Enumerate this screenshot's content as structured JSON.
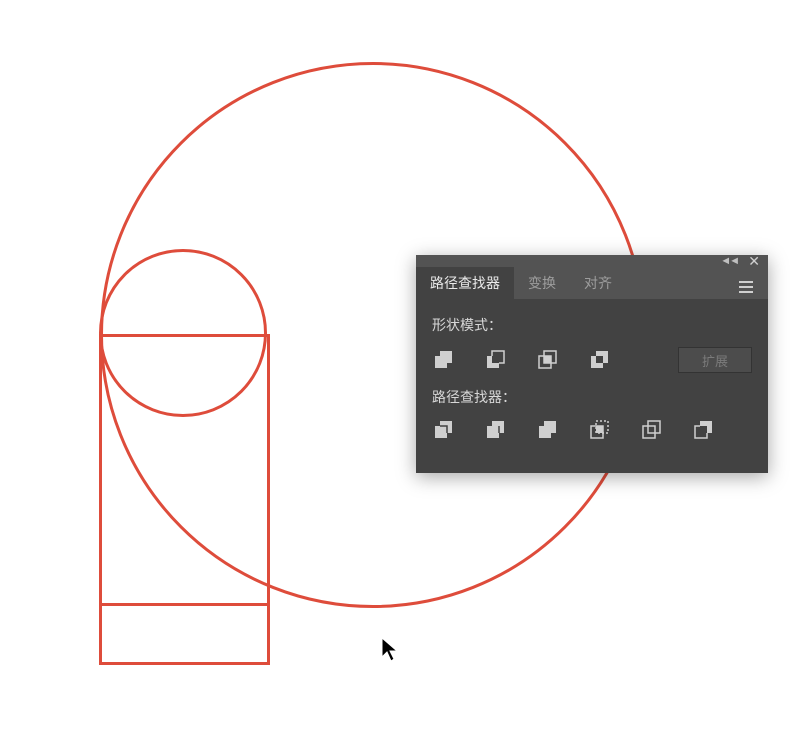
{
  "panel": {
    "tabs": [
      {
        "label": "路径查找器",
        "active": true
      },
      {
        "label": "变换",
        "active": false
      },
      {
        "label": "对齐",
        "active": false
      }
    ],
    "section_shape_modes": "形状模式：",
    "section_pathfinders": "路径查找器：",
    "expand_label": "扩展",
    "collapse_glyph": "◄◄",
    "close_glyph": "✕"
  },
  "icons": {
    "shape_modes": [
      "unite-icon",
      "minus-front-icon",
      "intersect-icon",
      "exclude-icon"
    ],
    "pathfinders": [
      "divide-icon",
      "trim-icon",
      "merge-icon",
      "crop-icon",
      "outline-icon",
      "minus-back-icon"
    ]
  },
  "shapes": {
    "stroke": "#de4c3b"
  }
}
